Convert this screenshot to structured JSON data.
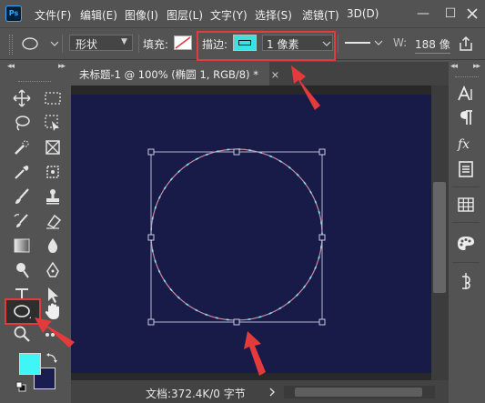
{
  "app": {
    "logo_text": "Ps"
  },
  "menu": [
    "文件(F)",
    "编辑(E)",
    "图像(I)",
    "图层(L)",
    "文字(Y)",
    "选择(S)",
    "滤镜(T)",
    "3D(D)"
  ],
  "window_controls": {
    "minimize": "—",
    "maximize": "☐"
  },
  "options_bar": {
    "shape_mode": "形状",
    "fill_label": "填充:",
    "stroke_label": "描边:",
    "stroke_width": "1 像素",
    "width_label": "W:",
    "width_value": "188 像",
    "stroke_color": "#3de0e0",
    "canvas_color": "#181a48"
  },
  "document": {
    "tab_title": "未标题-1 @ 100% (椭圆 1, RGB/8) *",
    "tab_close": "×"
  },
  "status": {
    "text": "文档:372.4K/0 字节"
  },
  "colors": {
    "foreground": "#3ff5f5",
    "background": "#1a1d4f",
    "annotation_red": "#e33b3b"
  },
  "icons": {
    "left_tools": [
      "move-icon",
      "marquee-icon",
      "lasso-icon",
      "object-select-icon",
      "eyedropper-icon",
      "frame-icon",
      "healing-icon",
      "stamp-icon",
      "brush-icon",
      "eraser-icon",
      "gradient-icon",
      "blur-icon",
      "dodge-icon",
      "pen-icon",
      "type-icon",
      "path-select-icon",
      "ellipse-icon",
      "hand-icon",
      "zoom-icon",
      "more-icon"
    ],
    "right_panel": [
      "character-icon",
      "paragraph-icon",
      "styles-icon",
      "properties-icon",
      "swatches-icon",
      "color-palette-icon",
      "puppet-icon"
    ]
  }
}
